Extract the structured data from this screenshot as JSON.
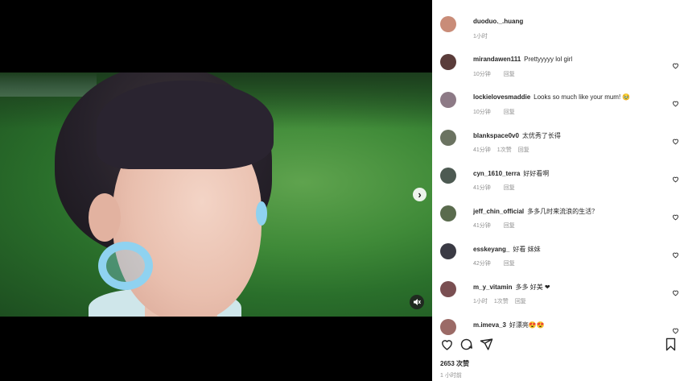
{
  "comments": [
    {
      "user": "duoduo._.huang",
      "text": "",
      "time": "1小时",
      "likes": "",
      "reply": "",
      "avatar_color": "#c98c78",
      "heart": false
    },
    {
      "user": "mirandawen111",
      "text": "Prettyyyyy lol girl",
      "time": "10分钟",
      "likes": "",
      "reply": "回复",
      "avatar_color": "#5a3c3a",
      "heart": true
    },
    {
      "user": "lockielovesmaddie",
      "text": "Looks so much like your mum! 🥹",
      "time": "10分钟",
      "likes": "",
      "reply": "回复",
      "avatar_color": "#8d7a86",
      "heart": true
    },
    {
      "user": "blankspace0v0",
      "text": "太优秀了长得",
      "time": "41分钟",
      "likes": "1次赞",
      "reply": "回复",
      "avatar_color": "#6b7361",
      "heart": true
    },
    {
      "user": "cyn_1610_terra",
      "text": "好好看啊",
      "time": "41分钟",
      "likes": "",
      "reply": "回复",
      "avatar_color": "#4d5a52",
      "heart": true
    },
    {
      "user": "jeff_chin_official",
      "text": "多多几时来流浪的生活？",
      "time": "41分钟",
      "likes": "",
      "reply": "回复",
      "avatar_color": "#5a6b4d",
      "heart": true
    },
    {
      "user": "esskeyang_",
      "text": "好看 妹妹",
      "time": "42分钟",
      "likes": "",
      "reply": "回复",
      "avatar_color": "#3a3a44",
      "heart": true
    },
    {
      "user": "m_y_vitamin",
      "text": "多多 好美 ❤",
      "time": "1小时",
      "likes": "1次赞",
      "reply": "回复",
      "avatar_color": "#7a4f52",
      "heart": true
    },
    {
      "user": "m.imeva_3",
      "text": "好漂亮😍😍",
      "time": "",
      "likes": "",
      "reply": "",
      "avatar_color": "#9b6a66",
      "heart": true
    }
  ],
  "likes_count": "2653 次赞",
  "post_time": "1 小时前",
  "next_arrow": "›"
}
